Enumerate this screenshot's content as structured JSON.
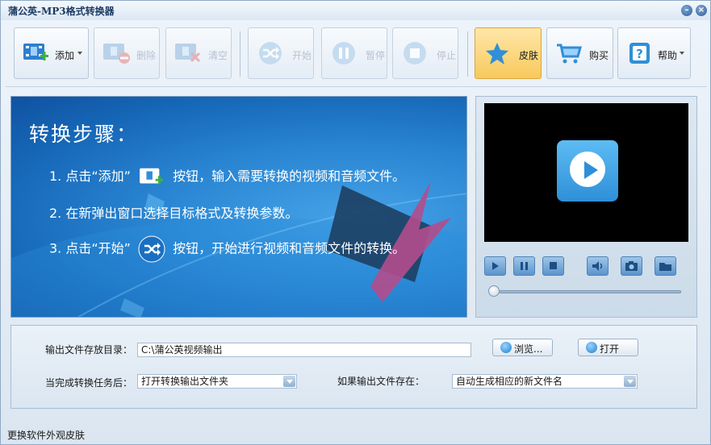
{
  "window": {
    "title": "蒲公英-MP3格式转换器",
    "minimize_glyph": "–",
    "close_glyph": "×"
  },
  "toolbar": {
    "add": {
      "label": "添加",
      "icon": "film-add-icon",
      "enabled": true,
      "has_dropdown": true
    },
    "delete": {
      "label": "删除",
      "icon": "film-remove-icon",
      "enabled": false
    },
    "clear": {
      "label": "清空",
      "icon": "film-clear-icon",
      "enabled": false
    },
    "start": {
      "label": "开始",
      "icon": "shuffle-icon",
      "enabled": false
    },
    "pause": {
      "label": "暂停",
      "icon": "pause-icon",
      "enabled": false
    },
    "stop": {
      "label": "停止",
      "icon": "stop-icon",
      "enabled": false
    },
    "skin": {
      "label": "皮肤",
      "icon": "star-icon",
      "enabled": true,
      "active": true
    },
    "buy": {
      "label": "购买",
      "icon": "cart-icon",
      "enabled": true
    },
    "help": {
      "label": "帮助",
      "icon": "question-icon",
      "enabled": true,
      "has_dropdown": true
    }
  },
  "guide": {
    "title": "转换步骤：",
    "step1_pre": "1. 点击“添加”",
    "step1_post": "按钮，输入需要转换的视频和音频文件。",
    "step2": "2. 在新弹出窗口选择目标格式及转换参数。",
    "step3_pre": "3. 点击“开始”",
    "step3_post": "按钮，开始进行视频和音频文件的转换。"
  },
  "player": {
    "controls": [
      "play-icon",
      "pause-icon",
      "stop-icon",
      "volume-icon",
      "camera-icon",
      "folder-icon"
    ],
    "progress": 0
  },
  "output": {
    "dir_label": "输出文件存放目录：",
    "dir_value": "C:\\蒲公英视频输出",
    "browse_label": "浏览...",
    "open_label": "打开",
    "after_label": "当完成转换任务后：",
    "after_value": "打开转换输出文件夹",
    "exists_label": "如果输出文件存在：",
    "exists_value": "自动生成相应的新文件名"
  },
  "status": {
    "text": "更换软件外观皮肤"
  },
  "colors": {
    "accent": "#2f8fd8",
    "skin_active": "#f8c95c",
    "guide_bg": "#1f7acb"
  }
}
